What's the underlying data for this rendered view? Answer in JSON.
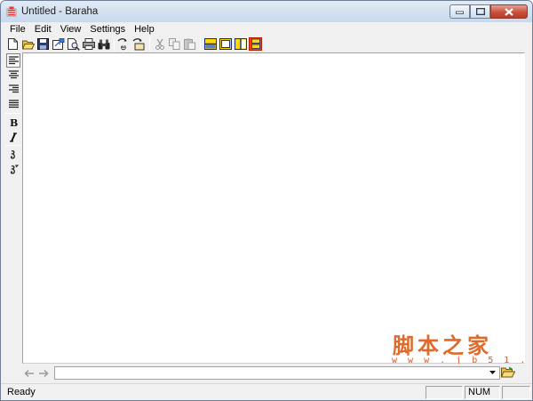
{
  "window": {
    "title": "Untitled - Baraha",
    "icon": "baraha-app-icon",
    "controls": [
      "minimize-icon",
      "maximize-icon",
      "close-icon"
    ]
  },
  "menubar": {
    "items": [
      "File",
      "Edit",
      "View",
      "Settings",
      "Help"
    ]
  },
  "toolbar": {
    "buttons": [
      "new-icon",
      "open-icon",
      "save-icon",
      "export-icon",
      "print-preview-icon",
      "print-icon",
      "find-icon",
      "convert-icon",
      "convert-options-icon",
      "cut-icon",
      "copy-icon",
      "paste-icon",
      "layout-horizontal-icon",
      "layout-single-icon",
      "layout-vertical-icon",
      "layout-stacked-icon"
    ]
  },
  "format_toolbar": {
    "buttons": [
      "align-left-icon",
      "align-center-icon",
      "align-right-icon",
      "justify-icon",
      "bold-icon",
      "italic-icon",
      "script-glyph-icon",
      "script-glyph-alt-icon"
    ]
  },
  "watermark": {
    "cn": "脚本之家",
    "url": "w w w . j b 5 1 . n e t"
  },
  "status": {
    "text": "Ready",
    "num": "NUM"
  },
  "colors": {
    "accent_yellow": "#ffd800",
    "close_red": "#c9503b",
    "watermark": "#e06a2b"
  }
}
